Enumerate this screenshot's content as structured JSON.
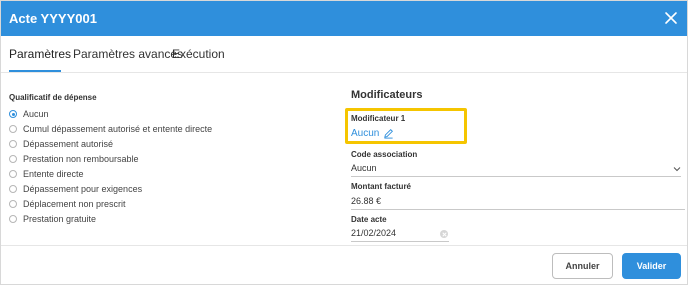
{
  "dialog": {
    "title": "Acte YYYY001",
    "close_icon": "close-icon"
  },
  "tabs": [
    {
      "label": "Paramètres",
      "active": true
    },
    {
      "label": "Paramètres avancés",
      "active": false
    },
    {
      "label": "Exécution",
      "active": false
    }
  ],
  "qualificatif": {
    "label": "Qualificatif de dépense",
    "options": [
      "Aucun",
      "Cumul dépassement autorisé et entente directe",
      "Dépassement autorisé",
      "Prestation non remboursable",
      "Entente directe",
      "Dépassement pour exigences",
      "Déplacement non prescrit",
      "Prestation gratuite"
    ],
    "selected_index": 0
  },
  "modificateurs": {
    "title": "Modificateurs",
    "modificateur1_label": "Modificateur 1",
    "modificateur1_value": "Aucun",
    "edit_icon": "edit-pencil-icon",
    "highlight_color": "#f5c500"
  },
  "code_association": {
    "label": "Code association",
    "value": "Aucun"
  },
  "montant_facture": {
    "label": "Montant facturé",
    "value": "26.88 €"
  },
  "date_acte": {
    "label": "Date acte",
    "value": "21/02/2024"
  },
  "buttons": {
    "cancel": "Annuler",
    "confirm": "Valider"
  },
  "colors": {
    "accent": "#2f8fdc"
  }
}
